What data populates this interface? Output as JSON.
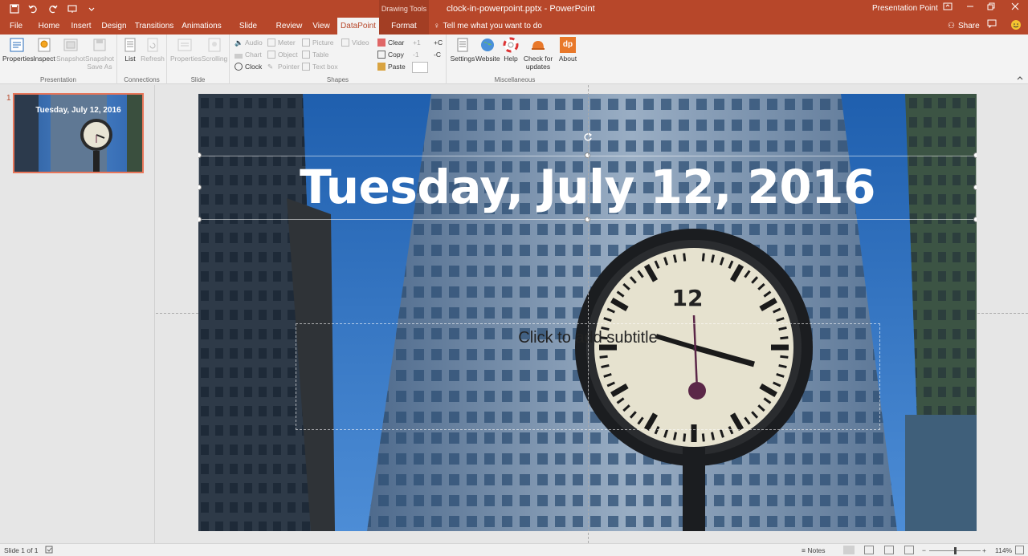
{
  "window": {
    "doc_title": "clock-in-powerpoint.pptx - PowerPoint",
    "context_title": "Drawing Tools",
    "account": "Presentation Point"
  },
  "tabs": [
    {
      "label": "File"
    },
    {
      "label": "Home"
    },
    {
      "label": "Insert"
    },
    {
      "label": "Design"
    },
    {
      "label": "Transitions"
    },
    {
      "label": "Animations"
    },
    {
      "label": "Slide Show"
    },
    {
      "label": "Review"
    },
    {
      "label": "View"
    },
    {
      "label": "DataPoint"
    },
    {
      "label": "Format"
    }
  ],
  "tell_me": "Tell me what you want to do",
  "share": "Share",
  "ribbon": {
    "presentation": {
      "label": "Presentation",
      "properties": "Properties",
      "inspect": "Inspect",
      "snapshot": "Snapshot",
      "snapshot_save_as_1": "Snapshot",
      "snapshot_save_as_2": "Save As"
    },
    "connections": {
      "label": "Connections",
      "list": "List",
      "refresh": "Refresh"
    },
    "slide": {
      "label": "Slide",
      "properties": "Properties",
      "scrolling": "Scrolling"
    },
    "shapes": {
      "label": "Shapes",
      "audio": "Audio",
      "chart": "Chart",
      "clock": "Clock",
      "meter": "Meter",
      "object": "Object",
      "pointer": "Pointer",
      "picture": "Picture",
      "table": "Table",
      "textbox": "Text box",
      "video": "Video",
      "clear": "Clear",
      "copy": "Copy",
      "paste": "Paste",
      "plus1": "+1",
      "minus1": "-1",
      "plusc": "+C",
      "minusc": "-C"
    },
    "misc": {
      "label": "Miscellaneous",
      "settings": "Settings",
      "website": "Website",
      "help": "Help",
      "check_1": "Check for",
      "check_2": "updates",
      "about": "About",
      "about_logo": "dp"
    }
  },
  "thumbnails": [
    {
      "number": "1",
      "title": "Tuesday, July 12, 2016"
    }
  ],
  "slide": {
    "title": "Tuesday, July 12, 2016",
    "subtitle_placeholder": "Click to add subtitle",
    "clock_numeral": "12"
  },
  "status": {
    "slide_info": "Slide 1 of 1",
    "notes": "Notes",
    "zoom": "114%"
  },
  "colors": {
    "accent": "#b7472a",
    "ribbon_bg": "#f3f3f3"
  }
}
